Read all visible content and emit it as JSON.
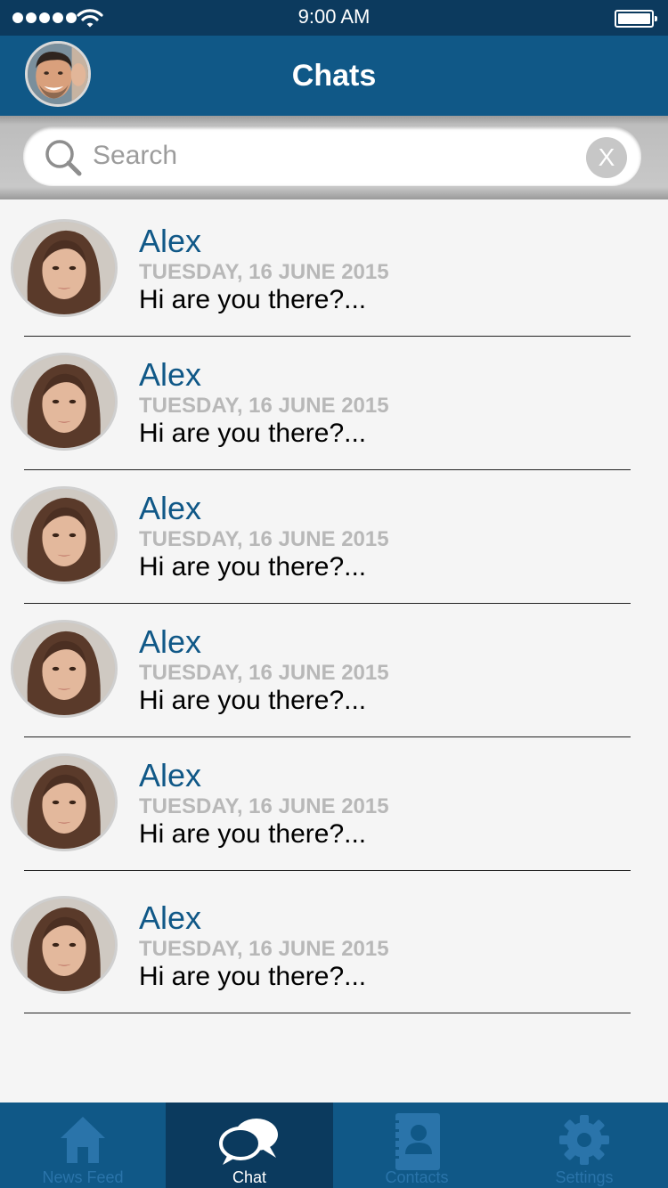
{
  "status_bar": {
    "time": "9:00 AM"
  },
  "header": {
    "title": "Chats"
  },
  "search": {
    "placeholder": "Search",
    "clear_label": "X"
  },
  "chats": [
    {
      "name": "Alex",
      "date": "TUESDAY, 16 JUNE 2015",
      "message": "Hi are you there?..."
    },
    {
      "name": "Alex",
      "date": "TUESDAY, 16 JUNE 2015",
      "message": "Hi are you there?..."
    },
    {
      "name": "Alex",
      "date": "TUESDAY, 16 JUNE 2015",
      "message": "Hi are you there?..."
    },
    {
      "name": "Alex",
      "date": "TUESDAY, 16 JUNE 2015",
      "message": "Hi are you there?..."
    },
    {
      "name": "Alex",
      "date": "TUESDAY, 16 JUNE 2015",
      "message": "Hi are you there?..."
    },
    {
      "name": "Alex",
      "date": "TUESDAY, 16 JUNE 2015",
      "message": "Hi are you there?..."
    }
  ],
  "tabs": [
    {
      "label": "News Feed",
      "icon": "home-icon",
      "active": false
    },
    {
      "label": "Chat",
      "icon": "chat-bubbles-icon",
      "active": true
    },
    {
      "label": "Contacts",
      "icon": "contacts-book-icon",
      "active": false
    },
    {
      "label": "Settings",
      "icon": "gear-icon",
      "active": false
    }
  ],
  "colors": {
    "status_bar": "#0c3a5e",
    "header": "#105887",
    "accent_name": "#105887",
    "date_text": "#b8b8b8",
    "tab_active": "#0b3a5e"
  }
}
